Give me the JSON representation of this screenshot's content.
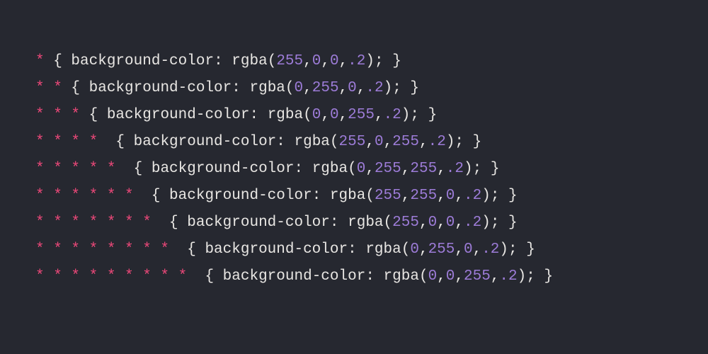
{
  "syntax_colors": {
    "selector": "#ec4879",
    "punctuation": "#e8e6e3",
    "property": "#e8e6e3",
    "function": "#e8e6e3",
    "number": "#9d7cd8",
    "background": "#262830"
  },
  "code": {
    "property": "background-color",
    "function": "rgba",
    "alpha": ".2",
    "lines": [
      {
        "depth": 1,
        "rgb": [
          "255",
          "0",
          "0"
        ],
        "gap_after_selector": " "
      },
      {
        "depth": 2,
        "rgb": [
          "0",
          "255",
          "0"
        ],
        "gap_after_selector": " "
      },
      {
        "depth": 3,
        "rgb": [
          "0",
          "0",
          "255"
        ],
        "gap_after_selector": " "
      },
      {
        "depth": 4,
        "rgb": [
          "255",
          "0",
          "255"
        ],
        "gap_after_selector": "  "
      },
      {
        "depth": 5,
        "rgb": [
          "0",
          "255",
          "255"
        ],
        "gap_after_selector": "  "
      },
      {
        "depth": 6,
        "rgb": [
          "255",
          "255",
          "0"
        ],
        "gap_after_selector": "  "
      },
      {
        "depth": 7,
        "rgb": [
          "255",
          "0",
          "0"
        ],
        "gap_after_selector": "  "
      },
      {
        "depth": 8,
        "rgb": [
          "0",
          "255",
          "0"
        ],
        "gap_after_selector": "  "
      },
      {
        "depth": 9,
        "rgb": [
          "0",
          "0",
          "255"
        ],
        "gap_after_selector": "  "
      }
    ]
  }
}
